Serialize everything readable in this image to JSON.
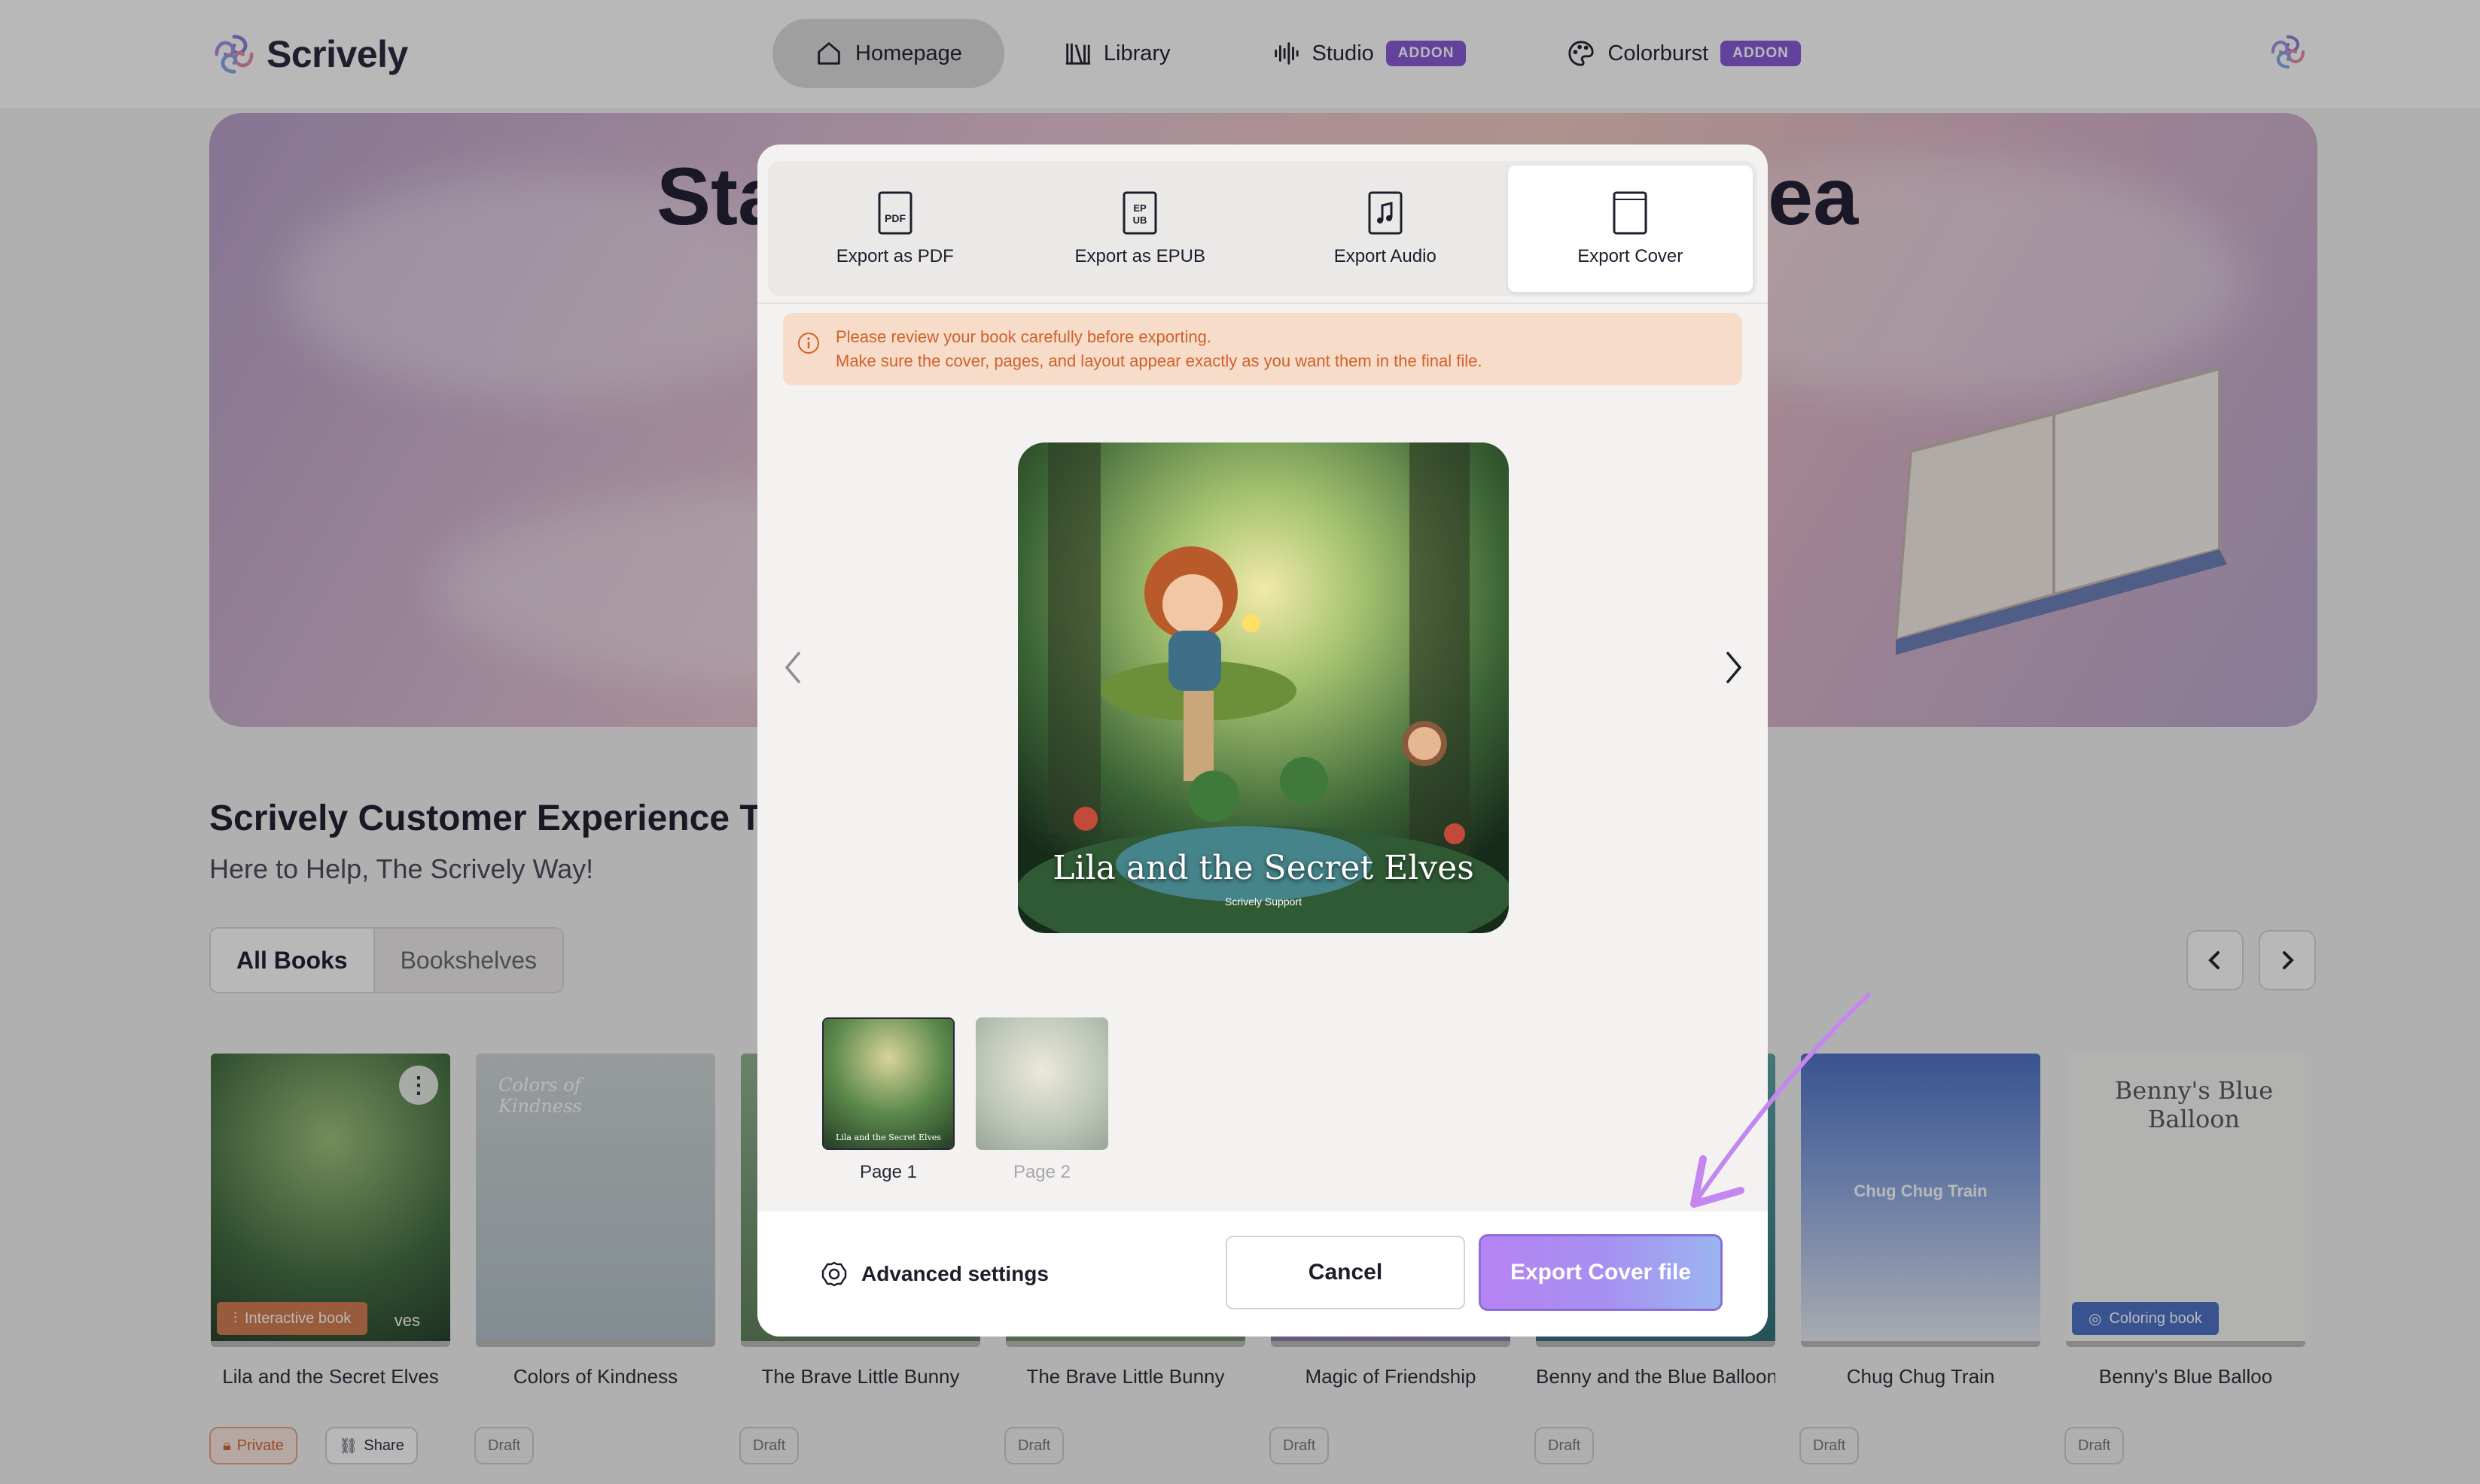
{
  "brand": {
    "name": "Scrively"
  },
  "nav": {
    "items": [
      {
        "label": "Homepage",
        "icon": "home-icon",
        "active": true
      },
      {
        "label": "Library",
        "icon": "library-icon"
      },
      {
        "label": "Studio",
        "icon": "audio-wave-icon",
        "badge": "ADDON"
      },
      {
        "label": "Colorburst",
        "icon": "palette-icon",
        "badge": "ADDON"
      }
    ]
  },
  "hero": {
    "title_left": "Sta",
    "title_right": "lea"
  },
  "section": {
    "title": "Scrively Customer Experience Te",
    "subtitle": "Here to Help, The Scrively Way!",
    "segments": [
      "All Books",
      "Bookshelves"
    ]
  },
  "books": [
    {
      "title": "Lila and the Secret Elves",
      "badge": "Interactive book",
      "tag_overlay": "ves"
    },
    {
      "title": "Colors of Kindness",
      "cover_text": "Colors of Kindness",
      "status": "Draft"
    },
    {
      "title": "The Brave Little Bunny",
      "status": "Draft"
    },
    {
      "title": "The Brave Little Bunny",
      "status": "Draft"
    },
    {
      "title": "Magic of Friendship",
      "status": "Draft"
    },
    {
      "title": "Benny and the Blue Balloon",
      "status": "Draft"
    },
    {
      "title": "Chug Chug Train",
      "cover_text": "Chug Chug Train",
      "status": "Draft"
    },
    {
      "title": "Benny's Blue Balloo",
      "cover_text": "Benny's Blue Balloon",
      "badge": "Coloring book",
      "status": "Draft"
    }
  ],
  "book_actions": {
    "private": "Private",
    "share": "Share"
  },
  "modal": {
    "tabs": [
      {
        "label": "Export as PDF",
        "icon": "pdf-file-icon"
      },
      {
        "label": "Export as EPUB",
        "icon": "epub-file-icon"
      },
      {
        "label": "Export Audio",
        "icon": "audio-file-icon"
      },
      {
        "label": "Export Cover",
        "icon": "cover-file-icon",
        "active": true
      }
    ],
    "alert": {
      "line1": "Please review your book carefully before exporting.",
      "line2": "Make sure the cover, pages, and layout appear exactly as you want them in the final file."
    },
    "preview": {
      "title": "Lila and the Secret Elves",
      "author": "Scrively Support"
    },
    "thumbnails": [
      {
        "label": "Page 1",
        "selected": true,
        "caption": "Lila and the Secret Elves"
      },
      {
        "label": "Page 2",
        "selected": false
      }
    ],
    "footer": {
      "advanced": "Advanced settings",
      "cancel": "Cancel",
      "export": "Export Cover file"
    }
  },
  "colors": {
    "accent": "#8656d6",
    "alert_bg": "#f7dcc9",
    "alert_text": "#d0612b"
  }
}
